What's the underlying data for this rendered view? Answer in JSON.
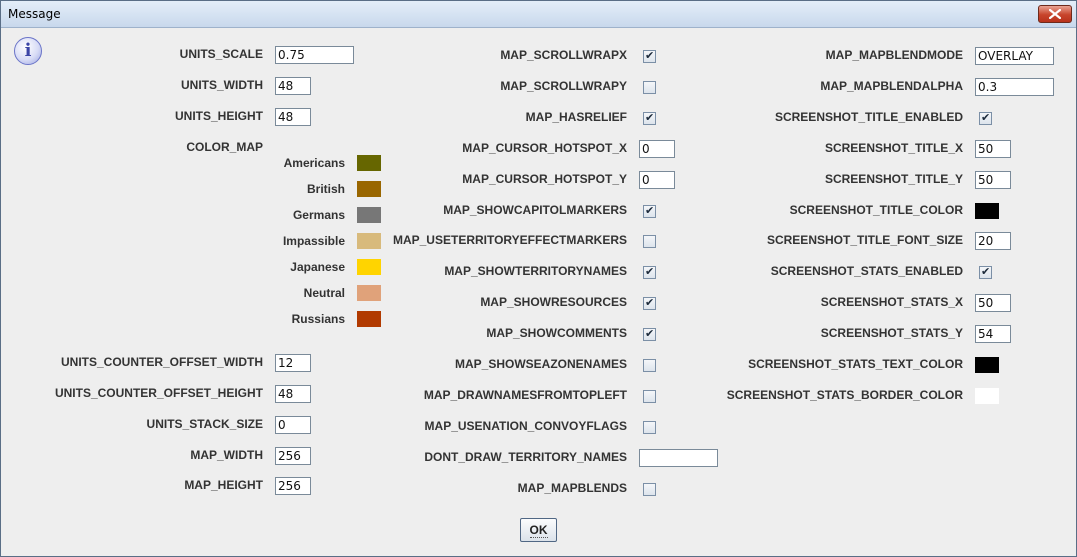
{
  "window": {
    "title": "Message",
    "ok_label": "OK"
  },
  "icon": "info-icon",
  "col1": {
    "fields": [
      {
        "label": "UNITS_SCALE",
        "value": "0.75"
      },
      {
        "label": "UNITS_WIDTH",
        "value": "48"
      },
      {
        "label": "UNITS_HEIGHT",
        "value": "48"
      }
    ],
    "color_map_label": "COLOR_MAP",
    "color_map": [
      {
        "name": "Americans",
        "color": "#666600"
      },
      {
        "name": "British",
        "color": "#996600"
      },
      {
        "name": "Germans",
        "color": "#777777"
      },
      {
        "name": "Impassible",
        "color": "#d8ba7c"
      },
      {
        "name": "Japanese",
        "color": "#ffd400"
      },
      {
        "name": "Neutral",
        "color": "#e0a27a"
      },
      {
        "name": "Russians",
        "color": "#b13a00"
      }
    ],
    "fields2": [
      {
        "label": "UNITS_COUNTER_OFFSET_WIDTH",
        "value": "12"
      },
      {
        "label": "UNITS_COUNTER_OFFSET_HEIGHT",
        "value": "48"
      },
      {
        "label": "UNITS_STACK_SIZE",
        "value": "0"
      },
      {
        "label": "MAP_WIDTH",
        "value": "256"
      },
      {
        "label": "MAP_HEIGHT",
        "value": "256"
      }
    ]
  },
  "col2": [
    {
      "label": "MAP_SCROLLWRAPX",
      "type": "check",
      "checked": true
    },
    {
      "label": "MAP_SCROLLWRAPY",
      "type": "check",
      "checked": false
    },
    {
      "label": "MAP_HASRELIEF",
      "type": "check",
      "checked": true
    },
    {
      "label": "MAP_CURSOR_HOTSPOT_X",
      "type": "text",
      "value": "0"
    },
    {
      "label": "MAP_CURSOR_HOTSPOT_Y",
      "type": "text",
      "value": "0"
    },
    {
      "label": "MAP_SHOWCAPITOLMARKERS",
      "type": "check",
      "checked": true
    },
    {
      "label": "MAP_USETERRITORYEFFECTMARKERS",
      "type": "check",
      "checked": false
    },
    {
      "label": "MAP_SHOWTERRITORYNAMES",
      "type": "check",
      "checked": true
    },
    {
      "label": "MAP_SHOWRESOURCES",
      "type": "check",
      "checked": true
    },
    {
      "label": "MAP_SHOWCOMMENTS",
      "type": "check",
      "checked": true
    },
    {
      "label": "MAP_SHOWSEAZONENAMES",
      "type": "check",
      "checked": false
    },
    {
      "label": "MAP_DRAWNAMESFROMTOPLEFT",
      "type": "check",
      "checked": false
    },
    {
      "label": "MAP_USENATION_CONVOYFLAGS",
      "type": "check",
      "checked": false
    },
    {
      "label": "DONT_DRAW_TERRITORY_NAMES",
      "type": "text",
      "value": ""
    },
    {
      "label": "MAP_MAPBLENDS",
      "type": "check",
      "checked": false
    }
  ],
  "col3": [
    {
      "label": "MAP_MAPBLENDMODE",
      "type": "text",
      "value": "OVERLAY"
    },
    {
      "label": "MAP_MAPBLENDALPHA",
      "type": "text",
      "value": "0.3"
    },
    {
      "label": "SCREENSHOT_TITLE_ENABLED",
      "type": "check",
      "checked": true
    },
    {
      "label": "SCREENSHOT_TITLE_X",
      "type": "text",
      "value": "50"
    },
    {
      "label": "SCREENSHOT_TITLE_Y",
      "type": "text",
      "value": "50"
    },
    {
      "label": "SCREENSHOT_TITLE_COLOR",
      "type": "color",
      "color": "#000000"
    },
    {
      "label": "SCREENSHOT_TITLE_FONT_SIZE",
      "type": "text",
      "value": "20"
    },
    {
      "label": "SCREENSHOT_STATS_ENABLED",
      "type": "check",
      "checked": true
    },
    {
      "label": "SCREENSHOT_STATS_X",
      "type": "text",
      "value": "50"
    },
    {
      "label": "SCREENSHOT_STATS_Y",
      "type": "text",
      "value": "54"
    },
    {
      "label": "SCREENSHOT_STATS_TEXT_COLOR",
      "type": "color",
      "color": "#000000"
    },
    {
      "label": "SCREENSHOT_STATS_BORDER_COLOR",
      "type": "color",
      "color": "#ffffff"
    }
  ]
}
